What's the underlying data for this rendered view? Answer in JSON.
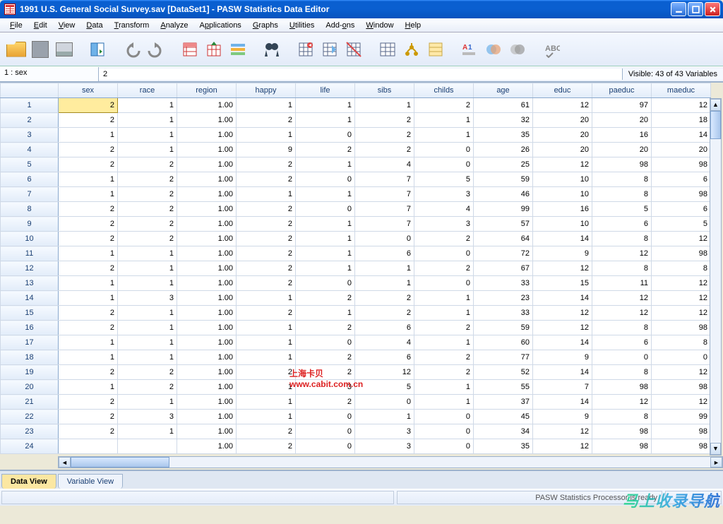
{
  "window": {
    "title": "1991 U.S. General Social Survey.sav [DataSet1] - PASW Statistics Data Editor"
  },
  "menu": [
    "File",
    "Edit",
    "View",
    "Data",
    "Transform",
    "Analyze",
    "Applications",
    "Graphs",
    "Utilities",
    "Add-ons",
    "Window",
    "Help"
  ],
  "cellbar": {
    "name": "1 : sex",
    "value": "2",
    "visible": "Visible: 43 of 43 Variables"
  },
  "columns": [
    "sex",
    "race",
    "region",
    "happy",
    "life",
    "sibs",
    "childs",
    "age",
    "educ",
    "paeduc",
    "maeduc"
  ],
  "rows": [
    {
      "n": 1,
      "v": [
        "2",
        "1",
        "1.00",
        "1",
        "1",
        "1",
        "2",
        "61",
        "12",
        "97",
        "12"
      ]
    },
    {
      "n": 2,
      "v": [
        "2",
        "1",
        "1.00",
        "2",
        "1",
        "2",
        "1",
        "32",
        "20",
        "20",
        "18"
      ]
    },
    {
      "n": 3,
      "v": [
        "1",
        "1",
        "1.00",
        "1",
        "0",
        "2",
        "1",
        "35",
        "20",
        "16",
        "14"
      ]
    },
    {
      "n": 4,
      "v": [
        "2",
        "1",
        "1.00",
        "9",
        "2",
        "2",
        "0",
        "26",
        "20",
        "20",
        "20"
      ]
    },
    {
      "n": 5,
      "v": [
        "2",
        "2",
        "1.00",
        "2",
        "1",
        "4",
        "0",
        "25",
        "12",
        "98",
        "98"
      ]
    },
    {
      "n": 6,
      "v": [
        "1",
        "2",
        "1.00",
        "2",
        "0",
        "7",
        "5",
        "59",
        "10",
        "8",
        "6"
      ]
    },
    {
      "n": 7,
      "v": [
        "1",
        "2",
        "1.00",
        "1",
        "1",
        "7",
        "3",
        "46",
        "10",
        "8",
        "98"
      ]
    },
    {
      "n": 8,
      "v": [
        "2",
        "2",
        "1.00",
        "2",
        "0",
        "7",
        "4",
        "99",
        "16",
        "5",
        "6"
      ]
    },
    {
      "n": 9,
      "v": [
        "2",
        "2",
        "1.00",
        "2",
        "1",
        "7",
        "3",
        "57",
        "10",
        "6",
        "5"
      ]
    },
    {
      "n": 10,
      "v": [
        "2",
        "2",
        "1.00",
        "2",
        "1",
        "0",
        "2",
        "64",
        "14",
        "8",
        "12"
      ]
    },
    {
      "n": 11,
      "v": [
        "1",
        "1",
        "1.00",
        "2",
        "1",
        "6",
        "0",
        "72",
        "9",
        "12",
        "98"
      ]
    },
    {
      "n": 12,
      "v": [
        "2",
        "1",
        "1.00",
        "2",
        "1",
        "1",
        "2",
        "67",
        "12",
        "8",
        "8"
      ]
    },
    {
      "n": 13,
      "v": [
        "1",
        "1",
        "1.00",
        "2",
        "0",
        "1",
        "0",
        "33",
        "15",
        "11",
        "12"
      ]
    },
    {
      "n": 14,
      "v": [
        "1",
        "3",
        "1.00",
        "1",
        "2",
        "2",
        "1",
        "23",
        "14",
        "12",
        "12"
      ]
    },
    {
      "n": 15,
      "v": [
        "2",
        "1",
        "1.00",
        "2",
        "1",
        "2",
        "1",
        "33",
        "12",
        "12",
        "12"
      ]
    },
    {
      "n": 16,
      "v": [
        "2",
        "1",
        "1.00",
        "1",
        "2",
        "6",
        "2",
        "59",
        "12",
        "8",
        "98"
      ]
    },
    {
      "n": 17,
      "v": [
        "1",
        "1",
        "1.00",
        "1",
        "0",
        "4",
        "1",
        "60",
        "14",
        "6",
        "8"
      ]
    },
    {
      "n": 18,
      "v": [
        "1",
        "1",
        "1.00",
        "1",
        "2",
        "6",
        "2",
        "77",
        "9",
        "0",
        "0"
      ]
    },
    {
      "n": 19,
      "v": [
        "2",
        "2",
        "1.00",
        "2",
        "2",
        "12",
        "2",
        "52",
        "14",
        "8",
        "12"
      ]
    },
    {
      "n": 20,
      "v": [
        "1",
        "2",
        "1.00",
        "1",
        "3",
        "5",
        "1",
        "55",
        "7",
        "98",
        "98"
      ]
    },
    {
      "n": 21,
      "v": [
        "2",
        "1",
        "1.00",
        "1",
        "2",
        "0",
        "1",
        "37",
        "14",
        "12",
        "12"
      ]
    },
    {
      "n": 22,
      "v": [
        "2",
        "3",
        "1.00",
        "1",
        "0",
        "1",
        "0",
        "45",
        "9",
        "8",
        "99"
      ]
    },
    {
      "n": 23,
      "v": [
        "2",
        "1",
        "1.00",
        "2",
        "0",
        "3",
        "0",
        "34",
        "12",
        "98",
        "98"
      ]
    },
    {
      "n": 24,
      "v": [
        "",
        "",
        "1.00",
        "2",
        "0",
        "3",
        "0",
        "35",
        "12",
        "98",
        "98"
      ]
    }
  ],
  "tabs": {
    "data": "Data View",
    "variable": "Variable View"
  },
  "status": {
    "processor": "PASW Statistics Processor is ready"
  },
  "watermark": {
    "line1": "上海卡贝",
    "line2": "www.cabit.com.cn"
  },
  "corner_wm": "马上收录导航"
}
